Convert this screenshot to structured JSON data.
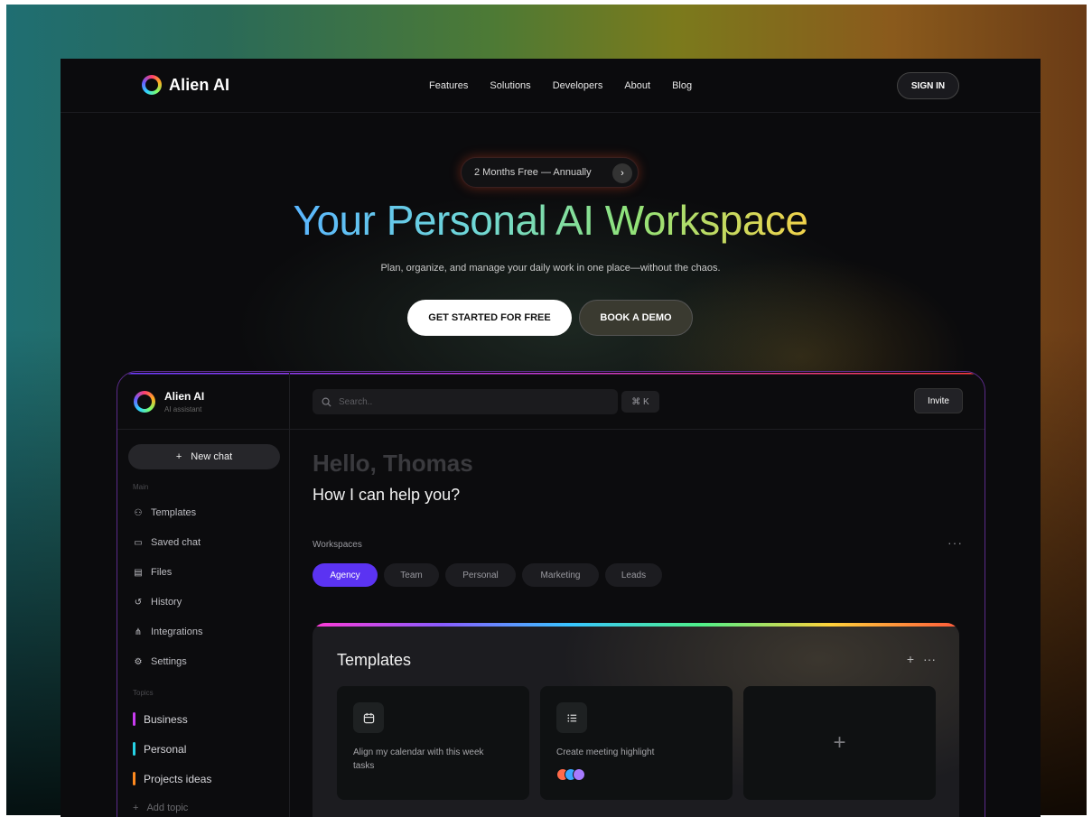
{
  "nav": {
    "brand": "Alien AI",
    "links": [
      "Features",
      "Solutions",
      "Developers",
      "About",
      "Blog"
    ],
    "signin": "SIGN IN"
  },
  "hero": {
    "promo": "2 Months Free — Annually",
    "promo_arrow": "›",
    "title": "Your Personal AI Workspace",
    "subtitle": "Plan, organize, and manage your daily work in one place—without the chaos.",
    "cta_primary": "GET STARTED FOR FREE",
    "cta_secondary": "BOOK A DEMO"
  },
  "app": {
    "brand": "Alien AI",
    "brand_sub": "AI assistant",
    "new_chat": "New chat",
    "new_chat_icon": "+",
    "main_label": "Main",
    "main_items": [
      {
        "label": "Templates",
        "icon": "template-icon",
        "glyph": "⚇"
      },
      {
        "label": "Saved chat",
        "icon": "chat-icon",
        "glyph": "▭"
      },
      {
        "label": "Files",
        "icon": "file-icon",
        "glyph": "▤"
      },
      {
        "label": "History",
        "icon": "history-icon",
        "glyph": "↺"
      },
      {
        "label": "Integrations",
        "icon": "integrations-icon",
        "glyph": "⋔"
      },
      {
        "label": "Settings",
        "icon": "gear-icon",
        "glyph": "⚙"
      }
    ],
    "topics_label": "Topics",
    "topics": [
      {
        "label": "Business",
        "color": "#c93cf0"
      },
      {
        "label": "Personal",
        "color": "#27d3e6"
      },
      {
        "label": "Projects ideas",
        "color": "#ff8a1f"
      }
    ],
    "add_topic": "Add topic",
    "search_placeholder": "Search..",
    "shortcut": "⌘ K",
    "invite": "Invite",
    "greeting": "Hello, Thomas",
    "prompt": "How I can help you?",
    "workspaces_label": "Workspaces",
    "workspaces": [
      "Agency",
      "Team",
      "Personal",
      "Marketing",
      "Leads"
    ],
    "active_workspace": "Agency",
    "templates": {
      "title": "Templates",
      "cards": [
        {
          "text": "Align my calendar with this week tasks",
          "icon": "calendar-icon"
        },
        {
          "text": "Create meeting highlight",
          "icon": "list-icon"
        }
      ],
      "avatar_colors": [
        "#ff6a4a",
        "#3aa7ff",
        "#a77bff"
      ]
    }
  },
  "colors": {
    "accent": "#5b33f2",
    "page_bg": "#0b0b0d"
  }
}
